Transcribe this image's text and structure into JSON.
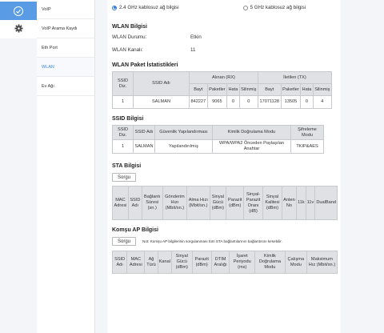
{
  "rail": {
    "items": [
      {
        "icon": "check-circle-icon"
      },
      {
        "icon": "gear-icon"
      }
    ]
  },
  "submenu": {
    "items": [
      "VoIP",
      "VoIP Arama Kaydı",
      "Eth Port",
      "WLAN",
      "Ev Ağı"
    ],
    "active": "WLAN"
  },
  "band": {
    "options": [
      "2.4 GHz kablosuz ağ bilgisi",
      "5 GHz kablosuz ağ bilgisi"
    ],
    "selected": 0
  },
  "wlan_info": {
    "title": "WLAN Bilgisi",
    "status_label": "WLAN Durumu:",
    "status_value": "Etkin",
    "channel_label": "WLAN Kanalı:",
    "channel_value": "11"
  },
  "stats": {
    "title": "WLAN Paket İstatistikleri",
    "h_ssid_index": "SSID Diz.",
    "h_ssid_name": "SSID Adı",
    "h_rx": "Alınan (RX)",
    "h_tx": "İletilen (TX)",
    "h_byte": "Bayt",
    "h_packets": "Paketler",
    "h_error": "Hata",
    "h_drop": "Silinmiş",
    "rows": [
      {
        "index": "1",
        "name": "SALMAN",
        "rx_byte": "842227",
        "rx_packets": "9065",
        "rx_error": "0",
        "rx_drop": "0",
        "tx_byte": "17071128",
        "tx_packets": "13505",
        "tx_error": "0",
        "tx_drop": "4"
      }
    ]
  },
  "ssid": {
    "title": "SSID Bilgisi",
    "headers": [
      "SSID Diz.",
      "SSID Adı",
      "Güvenlik Yapılandırması",
      "Kimlik Doğrulama Modu",
      "Şifreleme Modu"
    ],
    "rows": [
      [
        "1",
        "SALMAN",
        "Yapılandırılmış",
        "WPA/WPA2 Önceden Paylaşılan Anahtar",
        "TKIP&AES"
      ]
    ]
  },
  "sta": {
    "title": "STA Bilgisi",
    "button": "Sorgu",
    "headers": [
      "MAC Adresi",
      "SSID Adı",
      "Bağlantı Süresi (sn.)",
      "Gönderim Hızı (Mbit/sn.)",
      "Alma Hızı (Mbit/sn.)",
      "Sinyal Gücü (dBm)",
      "Parazit (dBm)",
      "Sinyal-Parazit Oranı (dB)",
      "Sinyal Kalitesi (dBm)",
      "Anten No",
      "11k",
      "11v",
      "DualBand"
    ]
  },
  "neighbor": {
    "title": "Komşu AP Bilgisi",
    "button": "Sorgu",
    "note": "Not: Komşu AP bilgilerinin sorgulanması tüm STA bağlantılarının bağlantısını kesebilir.",
    "headers": [
      "SSID Adı",
      "MAC Adresi",
      "Ağ Türü",
      "Kanal",
      "Sinyal Gücü (dBm)",
      "Parazit (dBm)",
      "DTIM Aralığı",
      "İşaret Periyodu (ms)",
      "Kimlik Doğrulama Modu",
      "Çalışma Modu",
      "Maksimum Hız (Mbit/sn.)"
    ]
  }
}
